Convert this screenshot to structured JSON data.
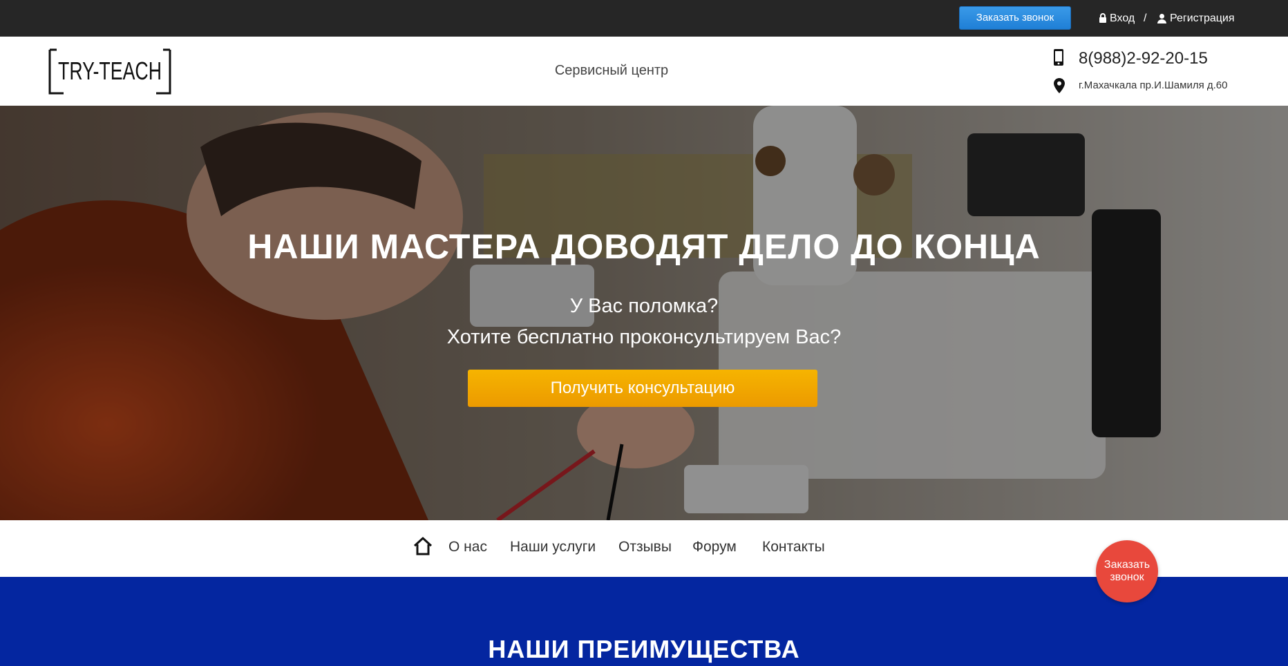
{
  "topbar": {
    "call_button": "Заказать звонок",
    "login": "Вход",
    "separator": "/",
    "register": "Регистрация"
  },
  "header": {
    "logo_text": "TRY-TEACH",
    "tagline": "Сервисный центр",
    "phone": "8(988)2-92-20-15",
    "address": "г.Махачкала пр.И.Шамиля д.60"
  },
  "hero": {
    "title": "НАШИ МАСТЕРА ДОВОДЯТ ДЕЛО ДО КОНЦА",
    "subtitle_1": "У Вас поломка?",
    "subtitle_2": "Хотите бесплатно проконсультируем Вас?",
    "cta": "Получить консультацию"
  },
  "nav": {
    "items": [
      "О нас",
      "Наши услуги",
      "Отзывы",
      "Форум",
      "Контакты"
    ]
  },
  "floating_call": {
    "line1": "Заказать",
    "line2": "звонок"
  },
  "advantages": {
    "title": "НАШИ ПРЕИМУЩЕСТВА"
  },
  "icons": {
    "lock": "lock-icon",
    "user": "user-icon",
    "phone": "mobile-phone-icon",
    "pin": "map-pin-icon",
    "home": "home-icon"
  },
  "colors": {
    "topbar": "#262626",
    "call_button": "#2384db",
    "cta": "#f0a500",
    "floating_call": "#e8483c",
    "band": "#0426a0"
  }
}
